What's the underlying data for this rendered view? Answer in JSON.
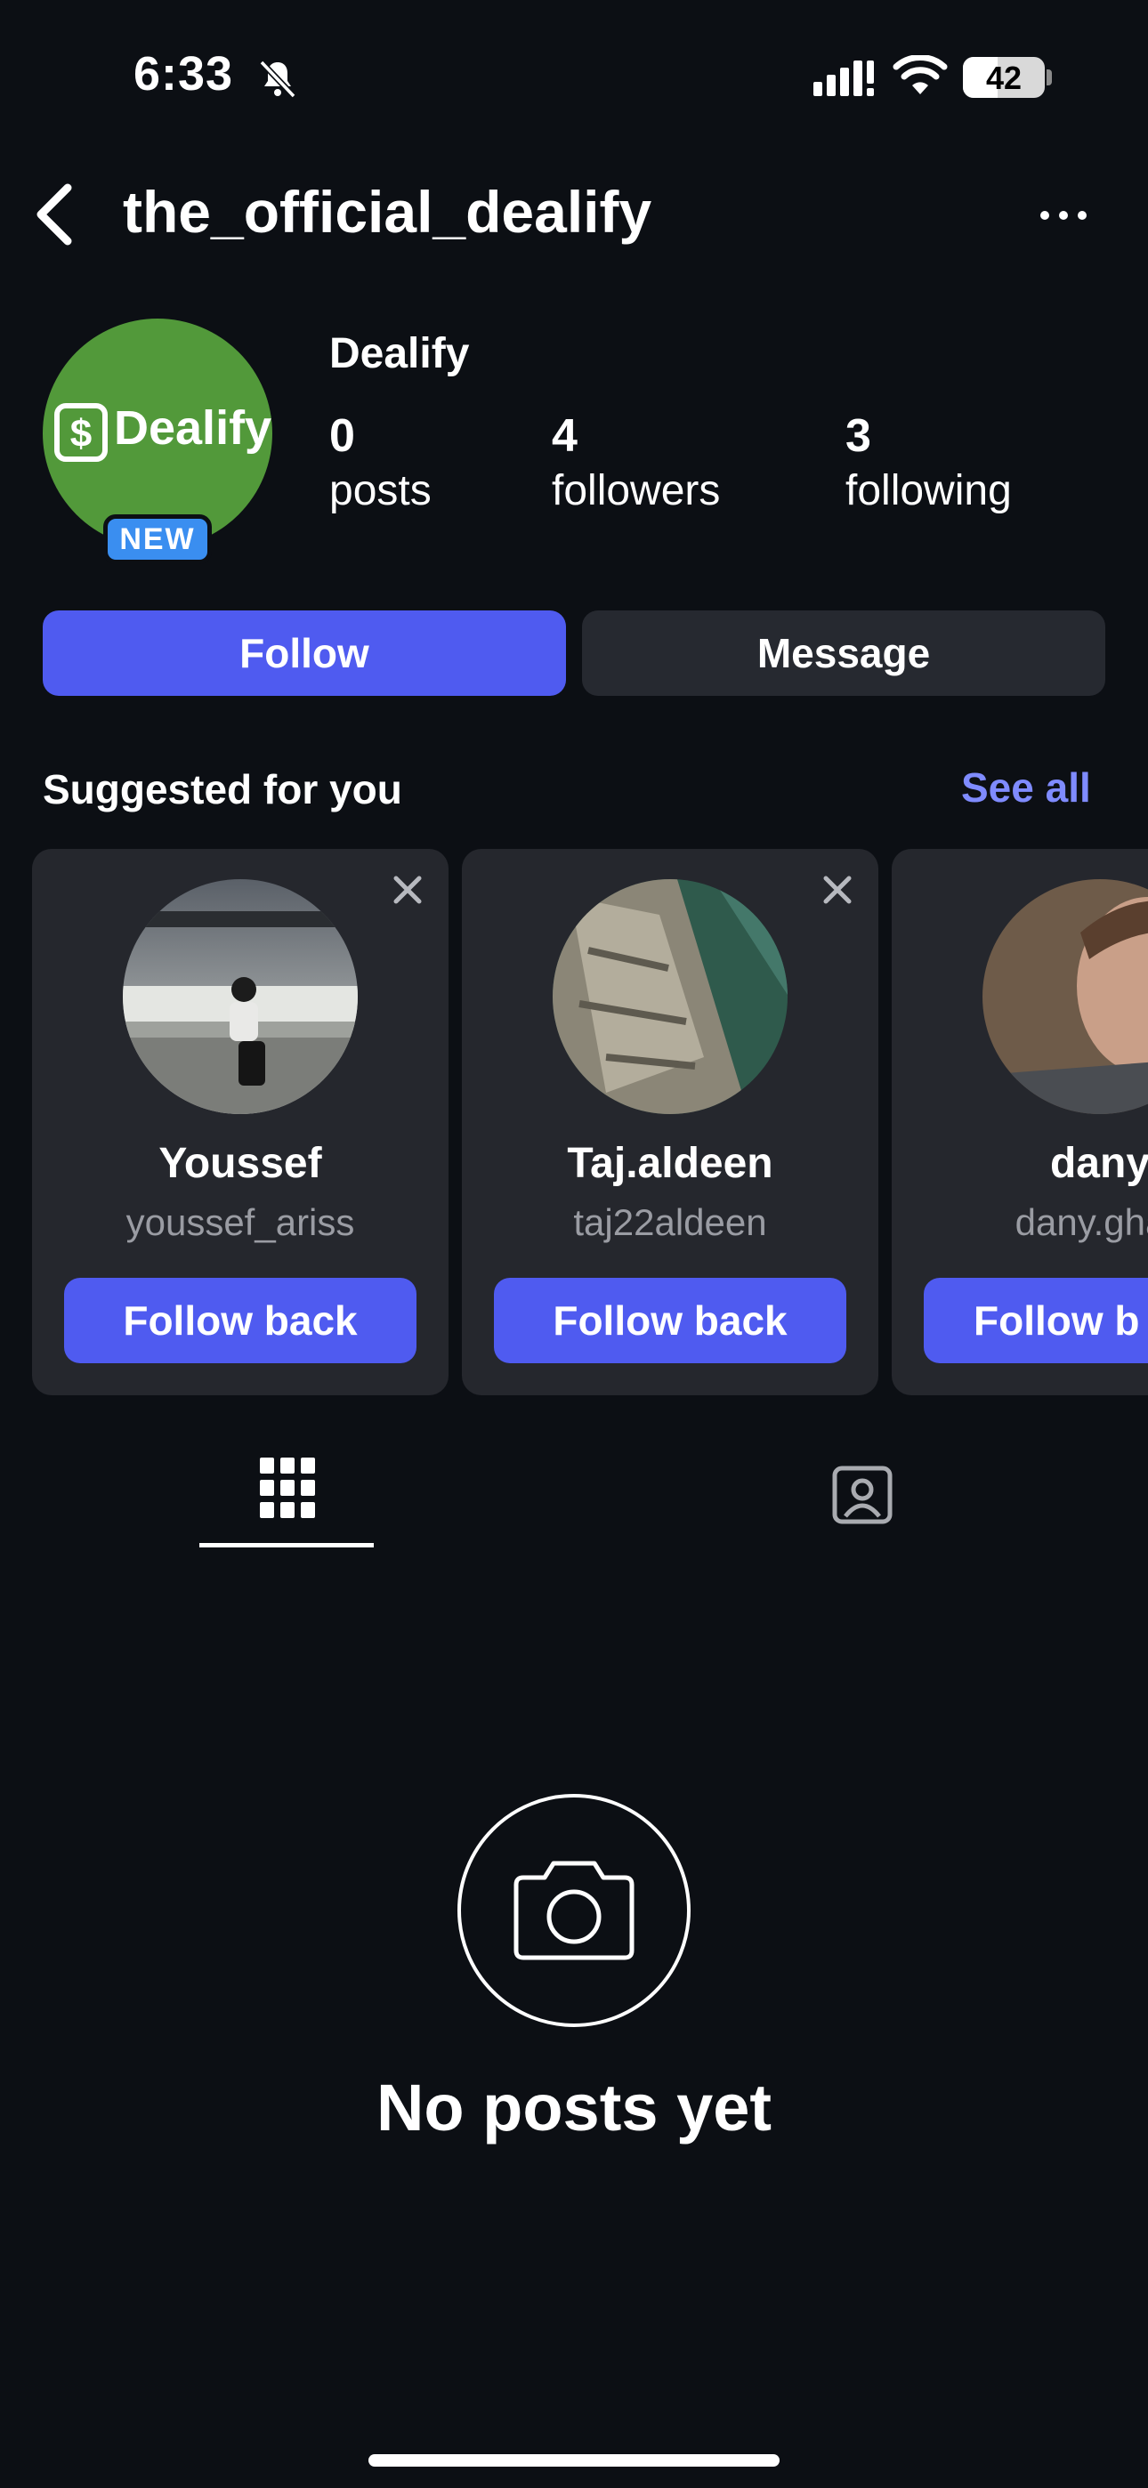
{
  "status_bar": {
    "time": "6:33",
    "battery": "42",
    "battery_level": 0.42
  },
  "header": {
    "username": "the_official_dealify"
  },
  "profile": {
    "avatar_text": "Dealify",
    "badge": "NEW",
    "display_name": "Dealify",
    "stats": [
      {
        "value": "0",
        "label": "posts"
      },
      {
        "value": "4",
        "label": "followers"
      },
      {
        "value": "3",
        "label": "following"
      }
    ],
    "avatar_color": "#52993a"
  },
  "actions": {
    "follow": "Follow",
    "message": "Message"
  },
  "suggestions": {
    "title": "Suggested for you",
    "see_all": "See all",
    "cards": [
      {
        "name": "Youssef",
        "handle": "youssef_ariss",
        "button": "Follow back"
      },
      {
        "name": "Taj.aldeen",
        "handle": "taj22aldeen",
        "button": "Follow back"
      },
      {
        "name": "dany",
        "handle": "dany.ghaz",
        "button": "Follow b"
      }
    ]
  },
  "tabs": {
    "icons": [
      "grid-icon",
      "tagged-icon"
    ],
    "active": "grid-icon"
  },
  "empty_state": {
    "text": "No posts yet",
    "icon": "camera-icon"
  },
  "colors": {
    "accent": "#4f5bf0",
    "link": "#7f8bff",
    "background": "#0c0f14",
    "card": "#25272d"
  }
}
